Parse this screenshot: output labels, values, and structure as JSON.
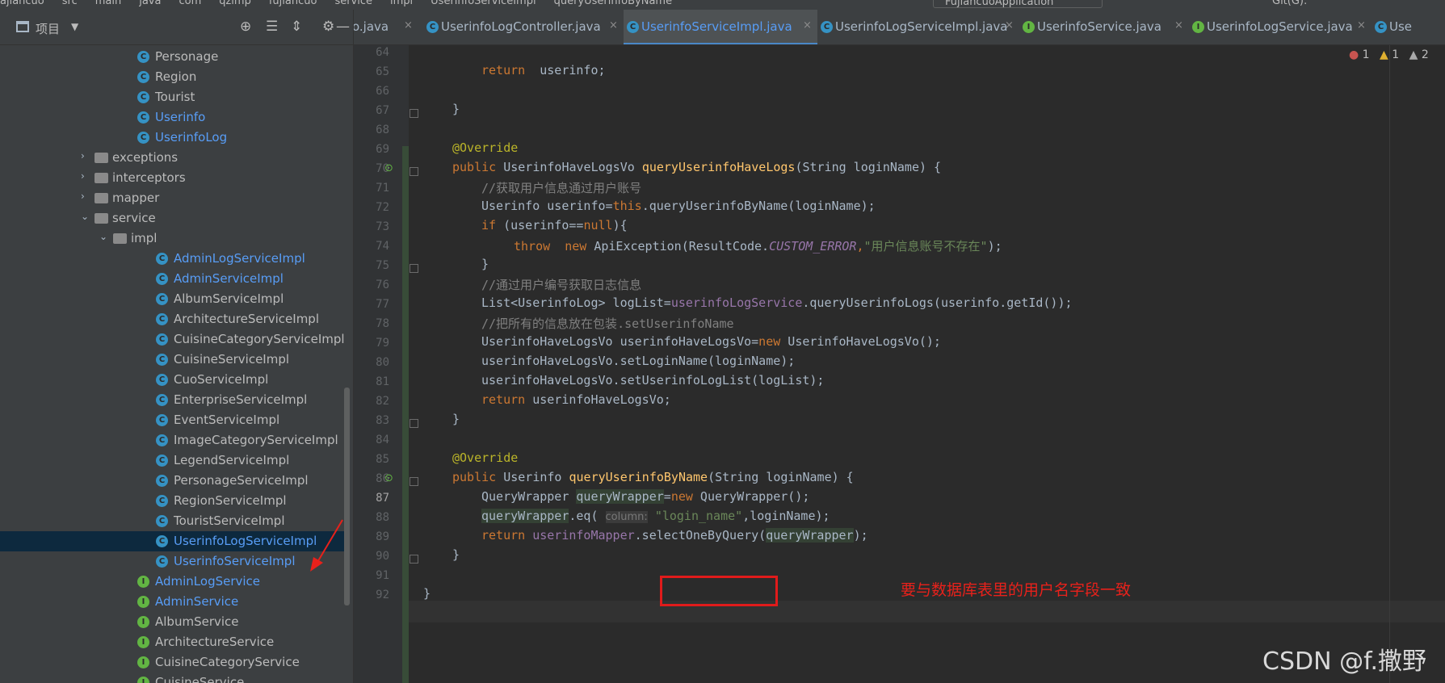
{
  "topbar": {
    "crumbs": [
      "ajiancuo",
      "src",
      "main",
      "java",
      "com",
      "qzimp",
      "fujiancuo",
      "service",
      "impl",
      "UserinfoServiceImpl",
      "queryUserinfoByName"
    ],
    "run_config": "FujiancuoApplication",
    "git_label": "Git(G):"
  },
  "project": {
    "title": "项目",
    "tree": [
      {
        "label": "Personage",
        "kind": "class",
        "style": "plain"
      },
      {
        "label": "Region",
        "kind": "class",
        "style": "plain"
      },
      {
        "label": "Tourist",
        "kind": "class",
        "style": "plain"
      },
      {
        "label": "Userinfo",
        "kind": "class",
        "style": "blue"
      },
      {
        "label": "UserinfoLog",
        "kind": "class",
        "style": "blue"
      },
      {
        "label": "exceptions",
        "kind": "folder",
        "style": "plain"
      },
      {
        "label": "interceptors",
        "kind": "folder",
        "style": "plain"
      },
      {
        "label": "mapper",
        "kind": "folder",
        "style": "plain"
      },
      {
        "label": "service",
        "kind": "folder",
        "style": "plain"
      },
      {
        "label": "impl",
        "kind": "folder",
        "style": "plain"
      },
      {
        "label": "AdminLogServiceImpl",
        "kind": "class",
        "style": "blue"
      },
      {
        "label": "AdminServiceImpl",
        "kind": "class",
        "style": "blue"
      },
      {
        "label": "AlbumServiceImpl",
        "kind": "class",
        "style": "plain"
      },
      {
        "label": "ArchitectureServiceImpl",
        "kind": "class",
        "style": "plain"
      },
      {
        "label": "CuisineCategoryServiceImpl",
        "kind": "class",
        "style": "plain"
      },
      {
        "label": "CuisineServiceImpl",
        "kind": "class",
        "style": "plain"
      },
      {
        "label": "CuoServiceImpl",
        "kind": "class",
        "style": "plain"
      },
      {
        "label": "EnterpriseServiceImpl",
        "kind": "class",
        "style": "plain"
      },
      {
        "label": "EventServiceImpl",
        "kind": "class",
        "style": "plain"
      },
      {
        "label": "ImageCategoryServiceImpl",
        "kind": "class",
        "style": "plain"
      },
      {
        "label": "LegendServiceImpl",
        "kind": "class",
        "style": "plain"
      },
      {
        "label": "PersonageServiceImpl",
        "kind": "class",
        "style": "plain"
      },
      {
        "label": "RegionServiceImpl",
        "kind": "class",
        "style": "plain"
      },
      {
        "label": "TouristServiceImpl",
        "kind": "class",
        "style": "plain"
      },
      {
        "label": "UserinfoLogServiceImpl",
        "kind": "class",
        "style": "blue",
        "selected": true
      },
      {
        "label": "UserinfoServiceImpl",
        "kind": "class",
        "style": "blue"
      },
      {
        "label": "AdminLogService",
        "kind": "interface",
        "style": "blue"
      },
      {
        "label": "AdminService",
        "kind": "interface",
        "style": "blue"
      },
      {
        "label": "AlbumService",
        "kind": "interface",
        "style": "plain"
      },
      {
        "label": "ArchitectureService",
        "kind": "interface",
        "style": "plain"
      },
      {
        "label": "CuisineCategoryService",
        "kind": "interface",
        "style": "plain"
      },
      {
        "label": "CuisineService",
        "kind": "interface",
        "style": "plain"
      }
    ]
  },
  "tabs": [
    {
      "label": "o.java",
      "kind": "none"
    },
    {
      "label": "UserinfoLogController.java",
      "kind": "class"
    },
    {
      "label": "UserinfoServiceImpl.java",
      "kind": "class",
      "active": true
    },
    {
      "label": "UserinfoLogServiceImpl.java",
      "kind": "class"
    },
    {
      "label": "UserinfoService.java",
      "kind": "interface"
    },
    {
      "label": "UserinfoLogService.java",
      "kind": "interface"
    },
    {
      "label": "Use",
      "kind": "class"
    }
  ],
  "inspections": {
    "errors": "1",
    "warnings": "1",
    "weak": "2"
  },
  "editor": {
    "line_numbers": [
      "64",
      "65",
      "66",
      "67",
      "68",
      "69",
      "70",
      "71",
      "72",
      "73",
      "74",
      "75",
      "76",
      "77",
      "78",
      "79",
      "80",
      "81",
      "82",
      "83",
      "84",
      "85",
      "86",
      "87",
      "88",
      "89",
      "90",
      "91",
      "92"
    ],
    "current_line": "87",
    "tokens": {
      "return": "return",
      "userinfo_semi": "userinfo;",
      "close_brace": "}",
      "override": "@Override",
      "public": "public",
      "ret_type_1": "UserinfoHaveLogsVo",
      "method_1": "queryUserinfoHaveLogs",
      "params": "(String loginName) {",
      "comment_1": "//获取用户信息通过用户账号",
      "l72_a": "Userinfo userinfo=",
      "this": "this",
      "l72_b": ".queryUserinfoByName(loginName);",
      "if": "if",
      "l73_a": " (userinfo==",
      "null": "null",
      "l73_b": "){",
      "throw": "throw",
      "new": "new",
      "l74_a": " ApiException(ResultCode.",
      "custom_error": "CUSTOM_ERROR",
      "comma": ",",
      "l74_str": "\"用户信息账号不存在\"",
      "l74_b": ");",
      "comment_2": "//通过用户编号获取日志信息",
      "l77_a": "List<UserinfoLog> logList=",
      "log_service": "userinfoLogService",
      "l77_b": ".queryUserinfoLogs(userinfo.getId());",
      "comment_3": "//把所有的信息放在包装.setUserinfoName",
      "l79_a": "UserinfoHaveLogsVo userinfoHaveLogsVo=",
      "l79_b": " UserinfoHaveLogsVo();",
      "l80": "userinfoHaveLogsVo.setLoginName(loginName);",
      "l81": "userinfoHaveLogsVo.setUserinfoLogList(logList);",
      "l82_b": " userinfoHaveLogsVo;",
      "ret_type_2": "Userinfo",
      "method_2": "queryUserinfoByName",
      "l87_a": "QueryWrapper ",
      "l87_var": "queryWrapper",
      "l87_b": "=",
      "l87_c": " QueryWrapper();",
      "qw": "queryWrapper",
      "l88_a": ".eq( ",
      "column_hint": "column:",
      "login_name": "\"login_name\"",
      "l88_b": ",loginName);",
      "mapper": "userinfoMapper",
      "l89_a": ".selectOneByQuery(",
      "l89_b": ");"
    }
  },
  "annotation": {
    "note": "要与数据库表里的用户名字段一致",
    "color": "#e8211b"
  },
  "watermark": "CSDN @f.撒野"
}
